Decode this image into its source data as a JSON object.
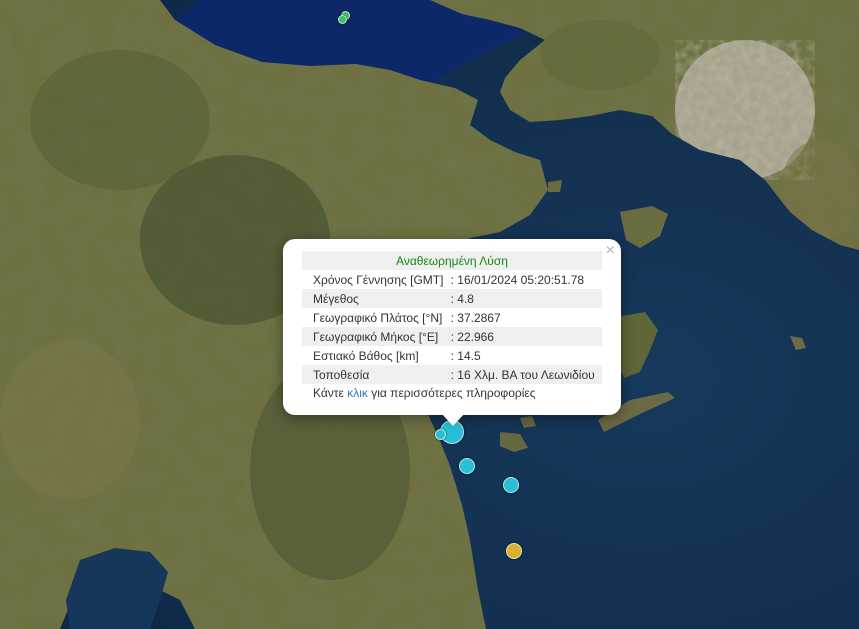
{
  "map": {
    "colors": {
      "sea": "#15375a",
      "gulf": "#0d2a66",
      "land": "#6f7141",
      "mountain": "#3e4a2a",
      "city": "#b3ac9c"
    }
  },
  "markers": [
    {
      "name": "quake-marker-main",
      "color": "cyan"
    },
    {
      "name": "quake-marker",
      "color": "cyan"
    },
    {
      "name": "quake-marker",
      "color": "cyan"
    },
    {
      "name": "quake-marker",
      "color": "cyan"
    },
    {
      "name": "quake-marker",
      "color": "yellow"
    },
    {
      "name": "quake-marker",
      "color": "green"
    },
    {
      "name": "quake-marker",
      "color": "green"
    }
  ],
  "popup": {
    "title": "Αναθεωρημένη Λύση",
    "close_glyph": "×",
    "rows": [
      {
        "label": "Χρόνος Γέννησης [GMT]",
        "value": ": 16/01/2024 05:20:51.78"
      },
      {
        "label": "Μέγεθος",
        "value": ": 4.8"
      },
      {
        "label": "Γεωγραφικό Πλάτος [°N]",
        "value": ": 37.2867"
      },
      {
        "label": "Γεωγραφικό Μήκος [°E]",
        "value": ": 22.966"
      },
      {
        "label": "Εστιακό Βάθος [km]",
        "value": ": 14.5"
      },
      {
        "label": "Τοποθεσία",
        "value": ": 16 Χλμ. ΒΑ του Λεωνιδίου"
      }
    ],
    "more_prefix": "Κάντε ",
    "more_link": "κλικ",
    "more_suffix": " για περισσότερες πληροφορίες",
    "title_color": "#188618",
    "link_color": "#2a7ab8"
  }
}
